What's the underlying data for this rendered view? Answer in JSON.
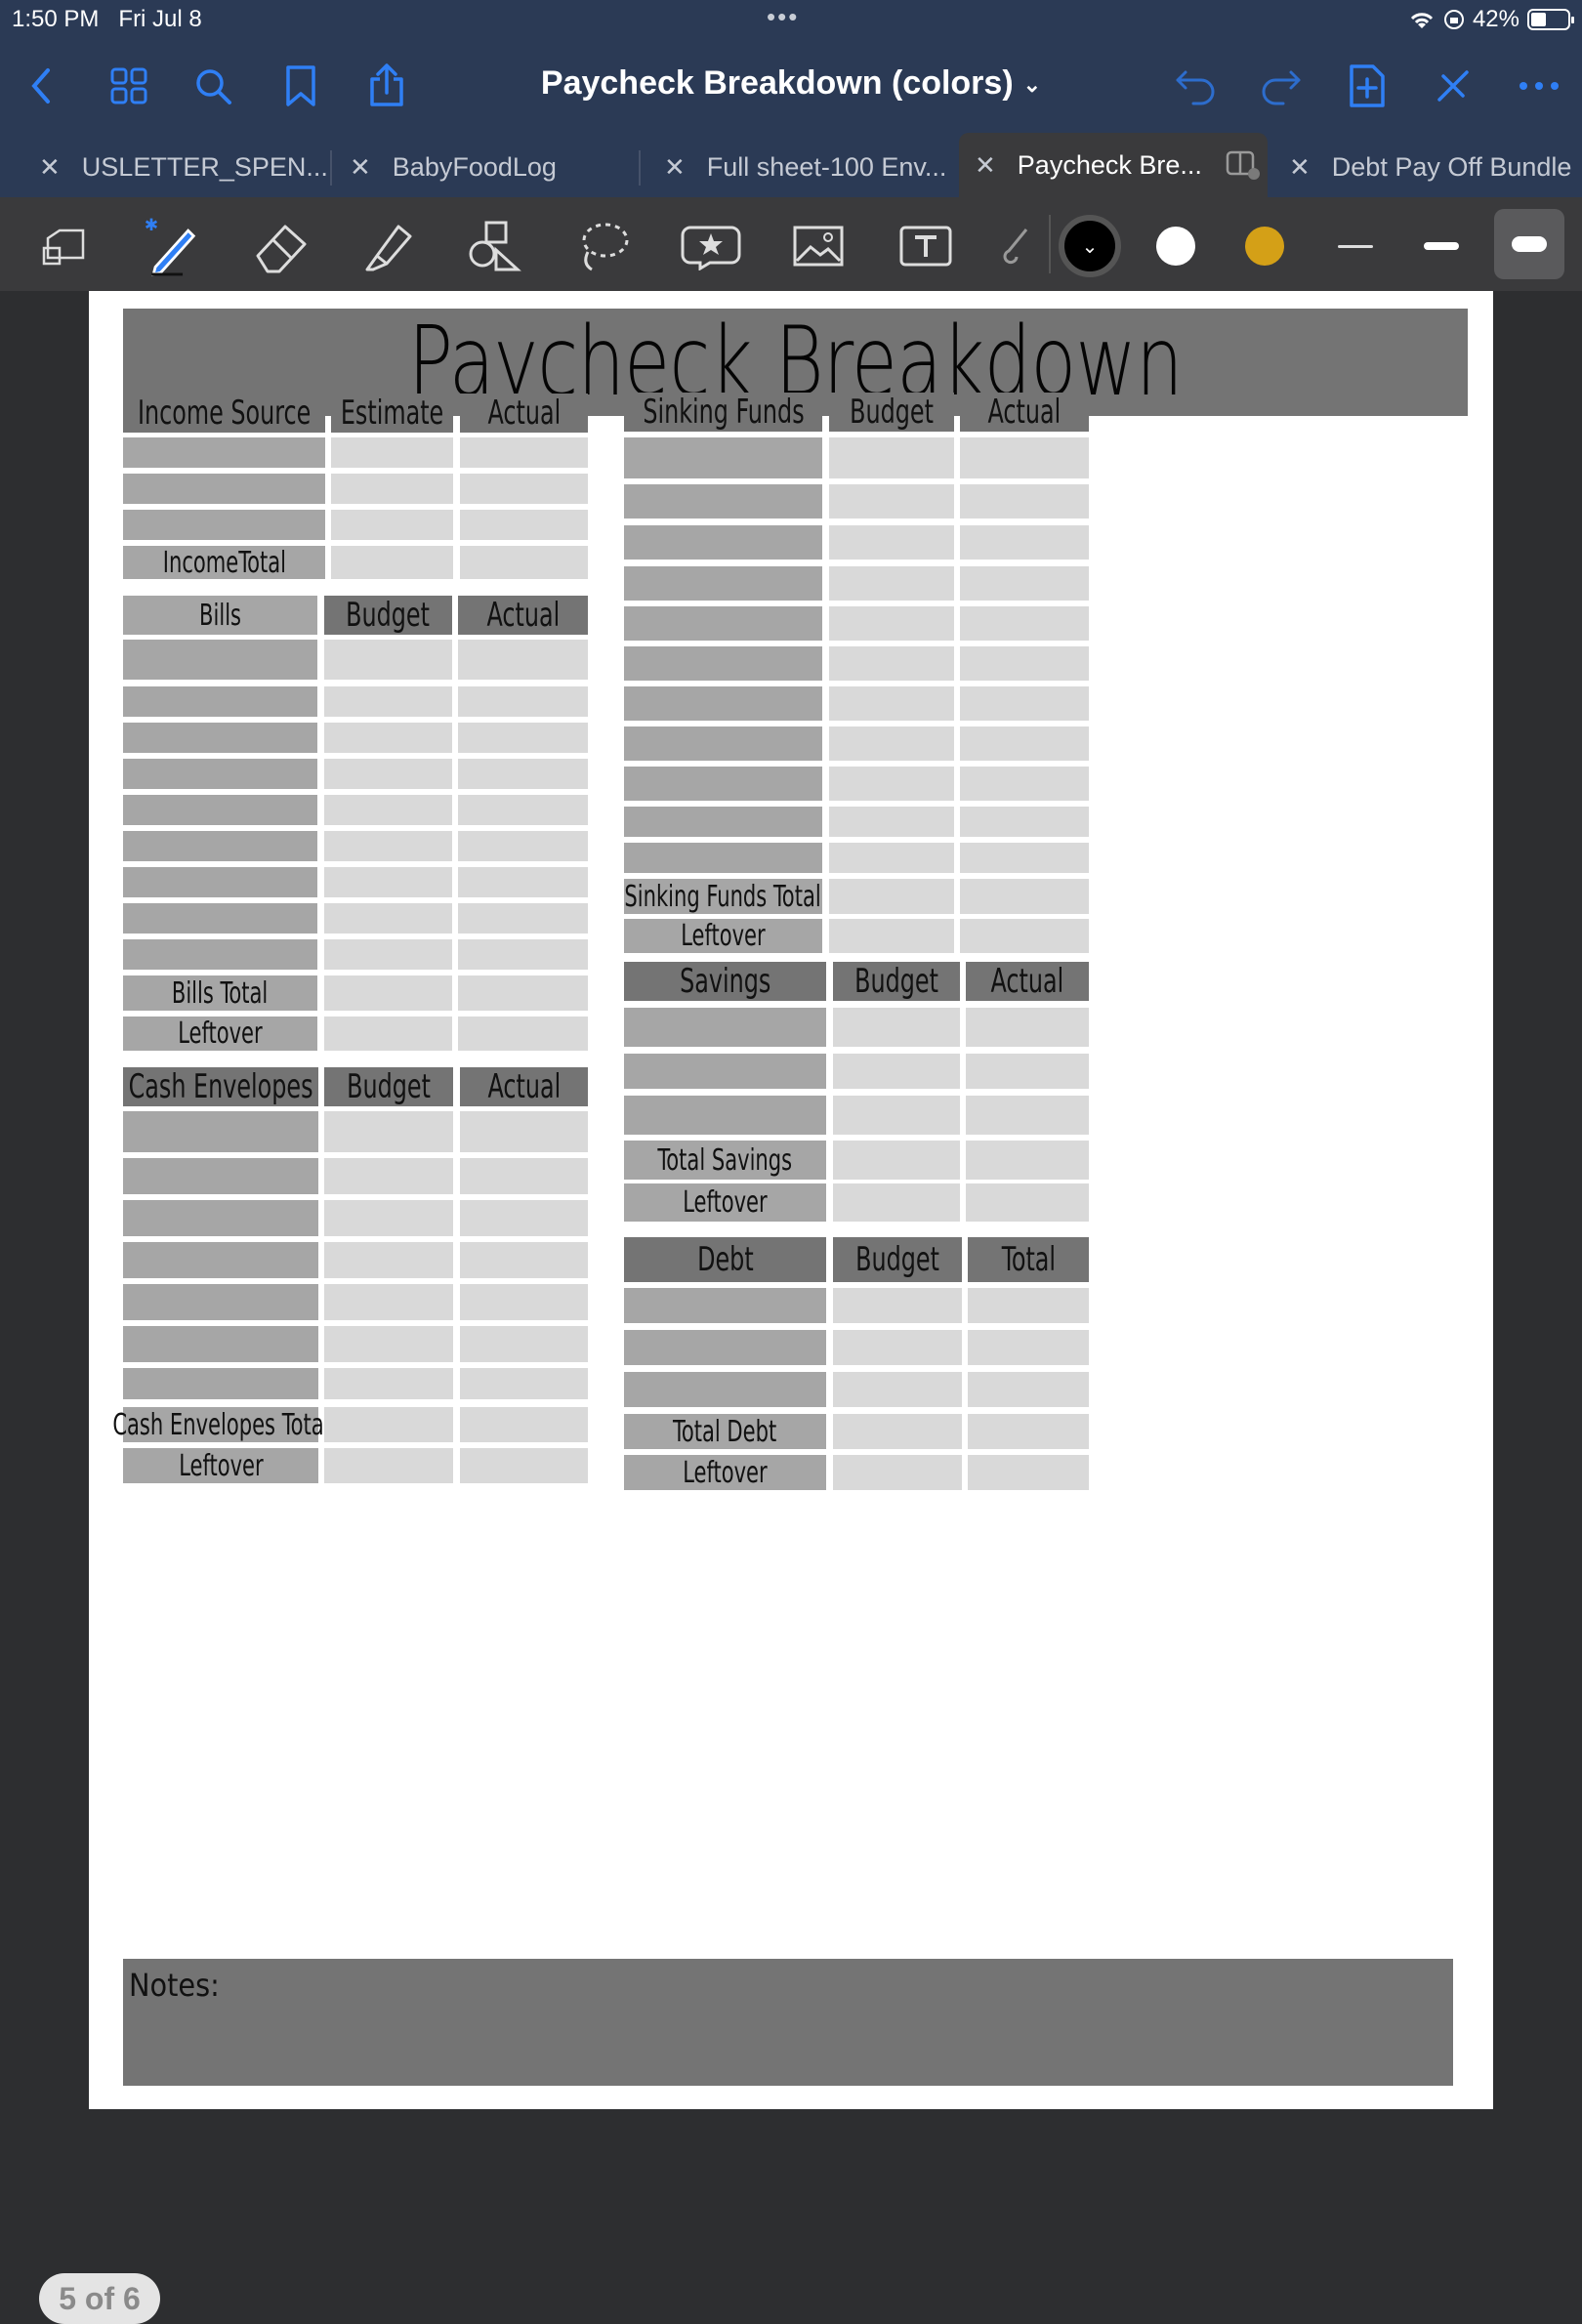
{
  "status": {
    "time": "1:50 PM",
    "date": "Fri Jul 8",
    "battery": "42%"
  },
  "nav": {
    "title": "Paycheck Breakdown (colors)"
  },
  "tabs": [
    "USLETTER_SPEN...",
    "BabyFoodLog",
    "Full sheet-100 Env...",
    "Paycheck Bre...",
    "Debt Pay Off Bundle"
  ],
  "active_tab_index": 3,
  "colors": {
    "black_swatch": "#000000",
    "white_swatch": "#ffffff",
    "yellow_swatch": "#d4a017",
    "accent": "#2f7ff5",
    "nav_bg": "#2b3a55"
  },
  "sheet": {
    "title": "Paycheck Breakdown",
    "income": {
      "headers": [
        "Income Source",
        "Estimate",
        "Actual"
      ],
      "total_label": "IncomeTotal"
    },
    "bills": {
      "headers": [
        "Bills",
        "Budget",
        "Actual"
      ],
      "total_label": "Bills Total",
      "leftover_label": "Leftover"
    },
    "cash": {
      "headers": [
        "Cash Envelopes",
        "Budget",
        "Actual"
      ],
      "total_label": "Cash Envelopes Total",
      "leftover_label": "Leftover"
    },
    "sinking": {
      "headers": [
        "Sinking Funds",
        "Budget",
        "Actual"
      ],
      "total_label": "Sinking Funds Total",
      "leftover_label": "Leftover"
    },
    "savings": {
      "headers": [
        "Savings",
        "Budget",
        "Actual"
      ],
      "total_label": "Total Savings",
      "leftover_label": "Leftover"
    },
    "debt": {
      "headers": [
        "Debt",
        "Budget",
        "Total"
      ],
      "total_label": "Total Debt",
      "leftover_label": "Leftover"
    },
    "notes_label": "Notes:"
  },
  "page_indicator": "5 of 6"
}
